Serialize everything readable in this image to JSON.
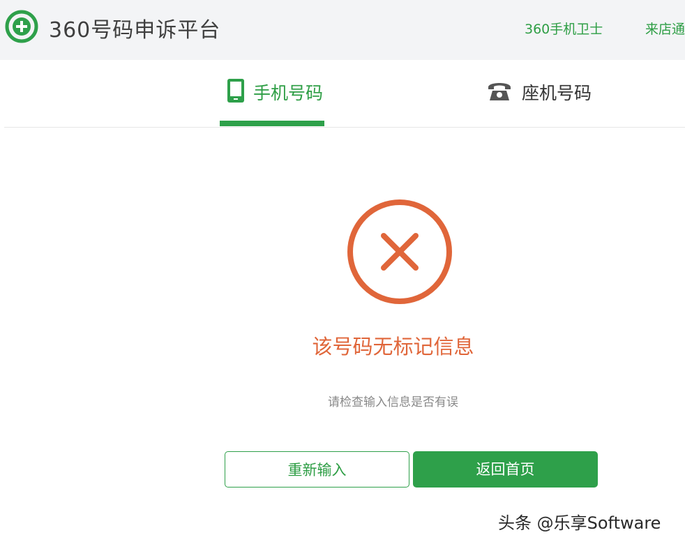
{
  "header": {
    "brand": "360号码申诉平台",
    "nav": [
      "360手机卫士",
      "来店通"
    ],
    "accent_color": "#2ea04a",
    "logo_icon": "plus-circle-icon"
  },
  "tabs": [
    {
      "label": "手机号码",
      "icon": "mobile-phone-icon",
      "active": true
    },
    {
      "label": "座机号码",
      "icon": "telephone-icon",
      "active": false
    }
  ],
  "result": {
    "icon": "error-x-circle-icon",
    "icon_color": "#e0663a",
    "title": "该号码无标记信息",
    "subtitle": "请检查输入信息是否有误"
  },
  "buttons": {
    "retry": "重新输入",
    "home": "返回首页"
  },
  "watermark": "头条 @乐享Software"
}
